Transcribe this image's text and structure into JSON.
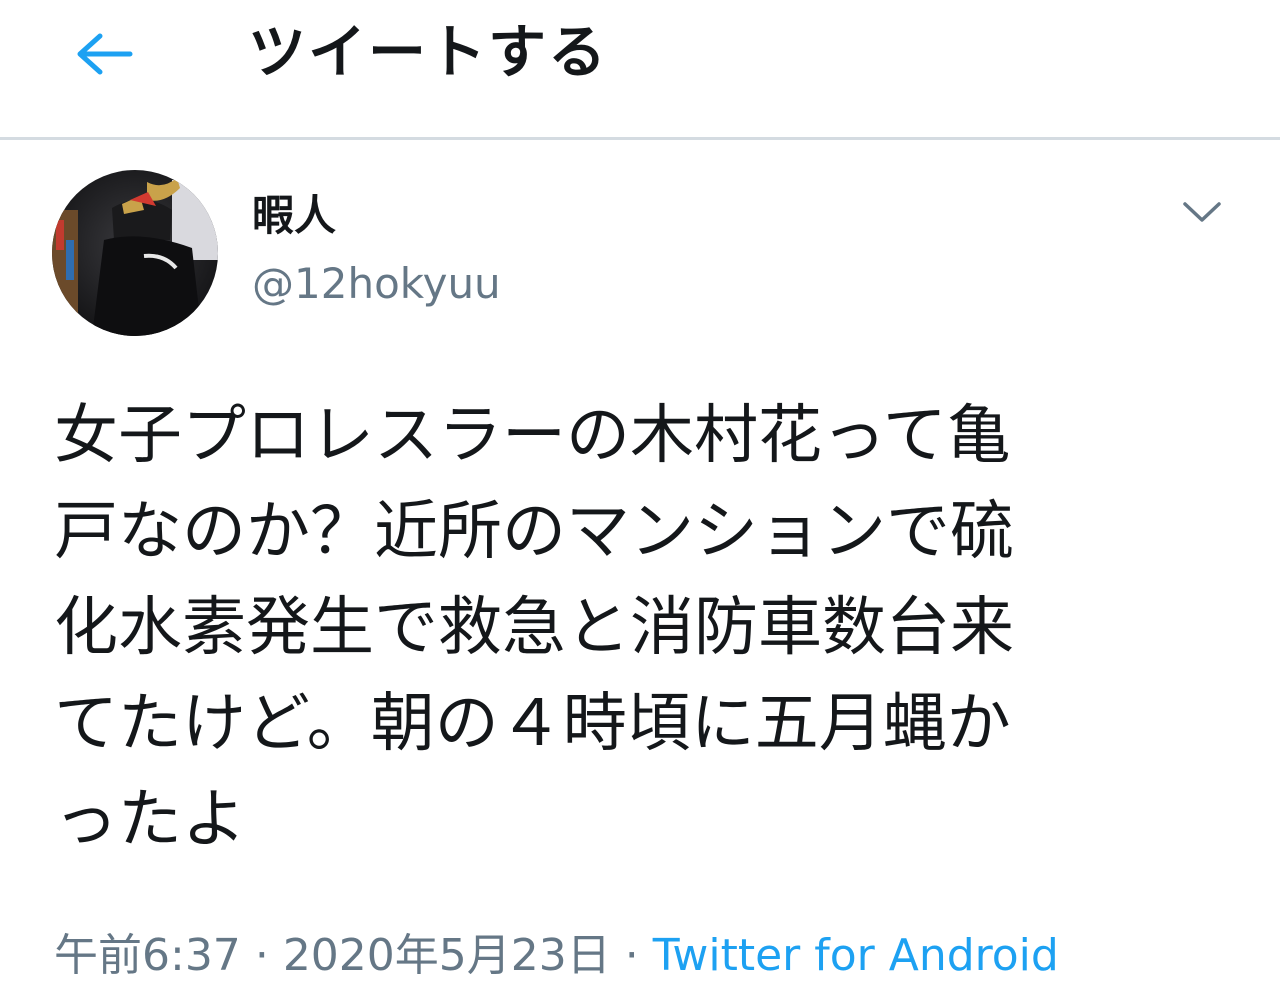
{
  "header": {
    "back_icon": "arrow-left-icon",
    "title": "ツイートする",
    "accent_color": "#1da1f2"
  },
  "tweet": {
    "author": {
      "display_name": "暇人",
      "handle": "@12hokyuu",
      "avatar_icon": "profile-photo"
    },
    "menu_icon": "chevron-down-icon",
    "text_lines": [
      "女子プロレスラーの木村花って亀",
      "戸なのか？近所のマンションで硫",
      "化水素発生で救急と消防車数台来",
      "てたけど。朝の４時頃に五月蝿か",
      "ったよ"
    ],
    "time": "午前6:37",
    "separator": "·",
    "date": "2020年5月23日",
    "source": "Twitter for Android",
    "source_color": "#1da1f2"
  }
}
